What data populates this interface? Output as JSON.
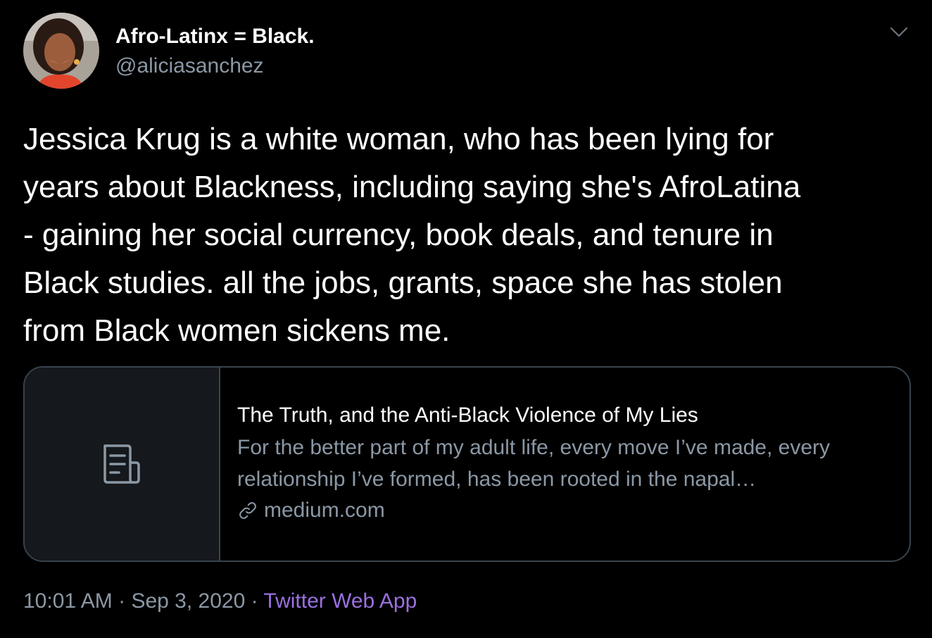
{
  "author": {
    "display_name": "Afro-Latinx = Black.",
    "handle": "@aliciasanchez"
  },
  "tweet": {
    "text": "Jessica Krug is a white woman, who has been lying for\nyears about Blackness, including saying she's AfroLatina\n- gaining her social currency, book deals, and tenure in\nBlack studies. all the jobs, grants, space she has stolen\nfrom Black women sickens me."
  },
  "card": {
    "title": "The Truth, and the Anti-Black Violence of My Lies",
    "description": "For the better part of my adult life, every move I’ve made, every relationship I’ve formed, has been rooted in the napal…",
    "domain": "medium.com",
    "thumb_icon": "document-icon"
  },
  "meta": {
    "time": "10:01 AM",
    "separator": "·",
    "date": "Sep 3, 2020",
    "source": "Twitter Web App"
  },
  "colors": {
    "background": "#000000",
    "text": "#ffffff",
    "secondary_text": "#8b98a5",
    "border": "#38444d",
    "source_link": "#9b70e0"
  }
}
